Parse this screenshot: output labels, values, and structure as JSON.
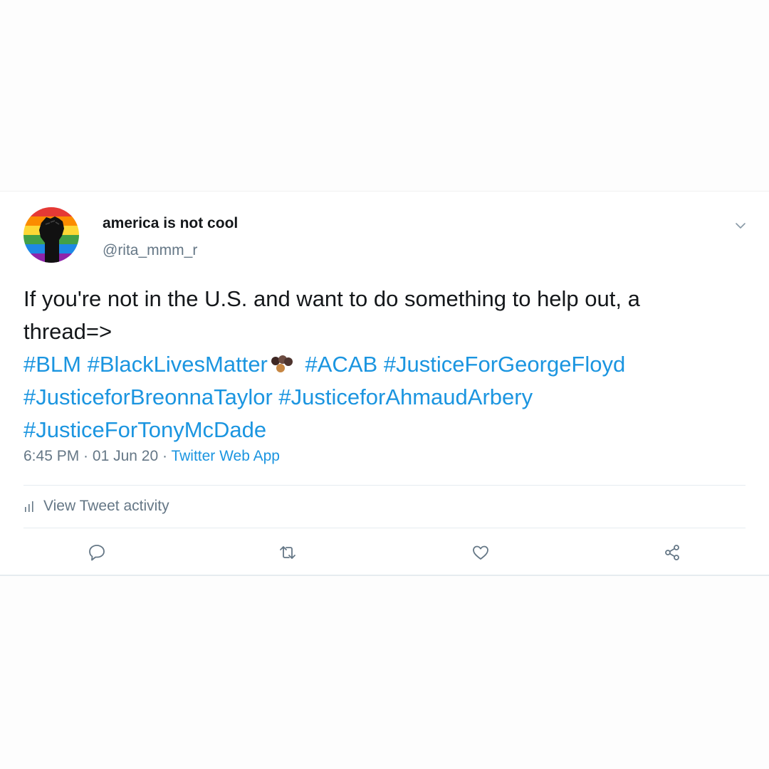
{
  "tweet": {
    "display_name": "america is not cool",
    "handle": "@rita_mmm_r",
    "text_line1": "If you're not in the U.S. and want to do something to help out, a",
    "text_line2": "thread=>",
    "hashtags": {
      "blm": "#BLM",
      "black_lives_matter": "#BlackLivesMatter",
      "acab": "#ACAB",
      "george_floyd": "#JusticeForGeorgeFloyd",
      "breonna_taylor": "#JusticeforBreonnaTaylor",
      "ahmaud_arbery": "#JusticeforAhmaudArbery",
      "tony_mcdade": "#JusticeForTonyMcDade"
    },
    "emoji": "brown-dots-emoji",
    "time": "6:45 PM",
    "date": "01 Jun 20",
    "separator": " · ",
    "source": "Twitter Web App"
  },
  "activity": {
    "label": "View Tweet activity",
    "icon": "bar-chart-icon"
  },
  "actions": {
    "reply_icon": "reply-icon",
    "retweet_icon": "retweet-icon",
    "like_icon": "heart-icon",
    "share_icon": "share-icon"
  },
  "colors": {
    "link": "#1b95e0",
    "text": "#14171a",
    "secondary": "#657786",
    "divider": "#e6ecf0"
  }
}
